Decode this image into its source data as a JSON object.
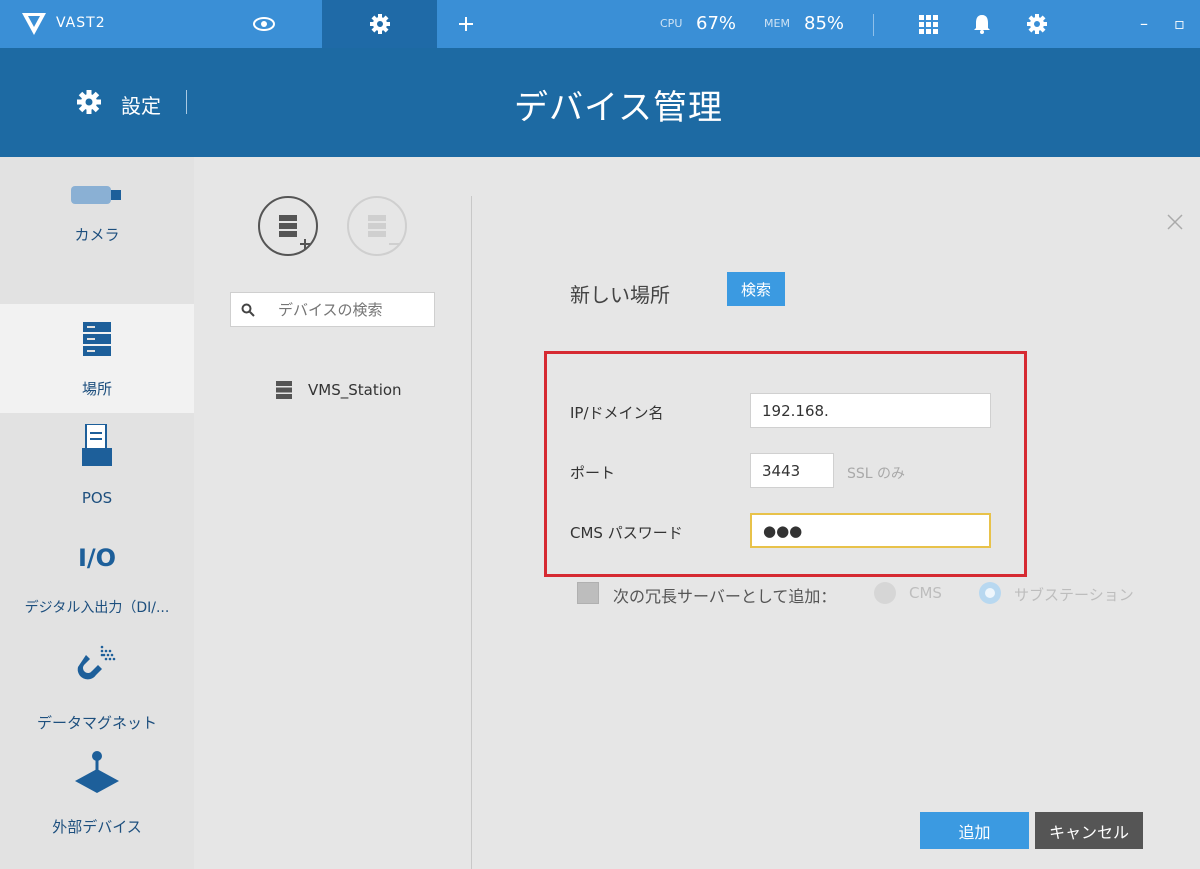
{
  "titlebar": {
    "app_name": "VAST2",
    "cpu_label": "CPU",
    "cpu_value": "67%",
    "mem_label": "MEM",
    "mem_value": "85%",
    "tabs": [
      {
        "icon": "eye-icon",
        "active": false
      },
      {
        "icon": "gear-icon",
        "active": true
      },
      {
        "icon": "plus-icon",
        "active": false
      }
    ],
    "right_icons": [
      "grid-icon",
      "bell-icon",
      "gear-icon"
    ],
    "window_buttons": {
      "minimize": "–",
      "maximize": "▫"
    }
  },
  "header": {
    "section_label": "設定",
    "title": "デバイス管理"
  },
  "sidebar": {
    "items": [
      {
        "label": "カメラ",
        "icon": "camera-icon",
        "active": false
      },
      {
        "label": "場所",
        "icon": "server-icon",
        "active": true
      },
      {
        "label": "POS",
        "icon": "pos-terminal-icon",
        "active": false
      },
      {
        "label": "デジタル入出力（DI/...",
        "icon": "io-icon",
        "icon_text": "I/O",
        "active": false
      },
      {
        "label": "データマグネット",
        "icon": "magnet-icon",
        "active": false
      },
      {
        "label": "外部デバイス",
        "icon": "joystick-icon",
        "active": false
      }
    ]
  },
  "device_list": {
    "search_placeholder": "デバイスの検索",
    "items": [
      {
        "label": "VMS_Station",
        "icon": "server-icon"
      }
    ]
  },
  "form": {
    "title": "新しい場所",
    "search_button": "検索",
    "ip_label": "IP/ドメイン名",
    "ip_value": "192.168.",
    "port_label": "ポート",
    "port_value": "3443",
    "ssl_note": "SSL のみ",
    "password_label": "CMS パスワード",
    "password_value": "●●●",
    "redundant_label": "次の冗長サーバーとして追加：",
    "redundant_checked": false,
    "radio_options": [
      {
        "label": "CMS",
        "selected": false
      },
      {
        "label": "サブステーション",
        "selected": true
      }
    ],
    "add_button": "追加",
    "cancel_button": "キャンセル"
  },
  "colors": {
    "topbar": "#3a8fd6",
    "header": "#1d6aa3",
    "accent": "#3b9ae1",
    "highlight_border": "#d62a32",
    "focus_border": "#e8c24a"
  }
}
